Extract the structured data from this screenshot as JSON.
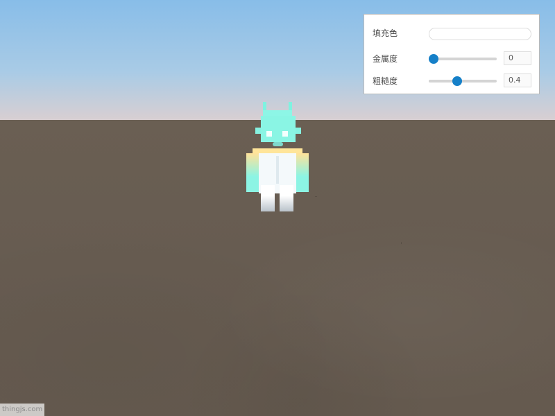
{
  "panel": {
    "fill_color": {
      "label": "填充色",
      "value": "#ffffff"
    },
    "metalness": {
      "label": "金属度",
      "value": "0",
      "level": 0.0
    },
    "roughness": {
      "label": "粗糙度",
      "value": "0.4",
      "level": 0.4
    }
  },
  "scene": {
    "sky_color": "#88bde8",
    "ground_color": "#685d52",
    "robot_color": "#8af5e4"
  },
  "watermark": {
    "text": "thingjs.com"
  },
  "colors": {
    "accent": "#1680c8"
  }
}
